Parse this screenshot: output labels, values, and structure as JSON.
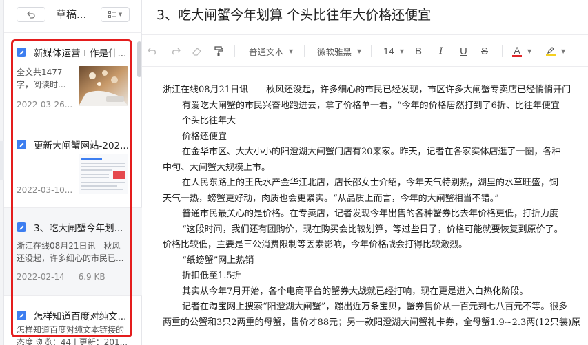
{
  "panel": {
    "title": "草稿...",
    "items": [
      {
        "title": "新媒体运营工作是什...",
        "excerpt_line1": "全文共1477",
        "excerpt_line2": "字，阅读时...",
        "date": "2022-03-26...",
        "size": ""
      },
      {
        "title": "更新大闸蟹网站-202...",
        "excerpt_line1": "",
        "excerpt_line2": "",
        "date": "2022-03-10...",
        "size": ""
      },
      {
        "title": "3、吃大闸蟹今年划...",
        "excerpt_line1": "浙江在线08月21日讯　秋风",
        "excerpt_line2": "还没起，许多细心的市民已...",
        "date": "2022-02-14",
        "size": "6.9 KB"
      },
      {
        "title": "怎样知道百度对纯文...",
        "excerpt_line1": "怎样知道百度对纯文本链接的",
        "excerpt_line2": "态度 浏览：44 | 更新：201...",
        "date": "",
        "size": ""
      }
    ]
  },
  "editor": {
    "title": "3、吃大闸蟹今年划算 个头比往年大价格还便宜",
    "toolbar": {
      "paragraph_style": "普通文本",
      "font_family": "微软雅黑",
      "font_size": "14",
      "bold": "B",
      "italic": "I",
      "underline": "U",
      "strike": "S",
      "font_color": "A"
    },
    "paragraphs": [
      "浙江在线08月21日讯　　秋风还没起，许多细心的市民已经发现，市区许多大闸蟹专卖店已经悄悄开门",
      "有爱吃大闸蟹的市民兴奋地跑进去，拿了价格单一看，“今年的价格居然打到了6折、比往年便宜",
      "个头比往年大",
      "价格还便宜",
      "在金华市区、大大小小的阳澄湖大闸蟹门店有20来家。昨天，记者在各家实体店逛了一圈，各种",
      "中旬、大闸蟹大规模上市。",
      "在人民东路上的王氏水产金华江北店，店长邵女士介绍，今年天气特别热，湖里的水草旺盛，饲",
      "天气一热，螃蟹更好动，肉质也会更紧实。“从品质上而言，今年的大闸蟹相当不错。”",
      "普通市民最关心的是价格。在专卖店，记者发现今年出售的各种蟹券比去年价格更低，打折力度",
      "“这段时间，我们还有团购价，现在购买会比较划算，等过些日子，价格可能就要恢复到原价了。",
      "价格比较低，主要是三公消费限制等因素影响，今年价格战会打得比较激烈。",
      "“纸螃蟹”网上热销",
      "折扣低至1.5折",
      "其实从今年7月开始，各个电商平台的蟹券大战就已经打响，现在更是进入白热化阶段。",
      "记者在淘宝网上搜索“阳澄湖大闸蟹”，蹦出近万条宝贝，蟹券售价从一百元到七八百元不等。很多",
      "两重的公蟹和3只2两重的母蟹，售价才88元；另一款阳澄湖大闸蟹礼卡券，全母蟹1.9~2.3两(12只装)原"
    ]
  },
  "colors": {
    "accent": "#3d7ef0",
    "highlight_box": "#e41d1d",
    "font_color_bar": "#e0262a",
    "highlight_color_bar": "#f5d020"
  }
}
